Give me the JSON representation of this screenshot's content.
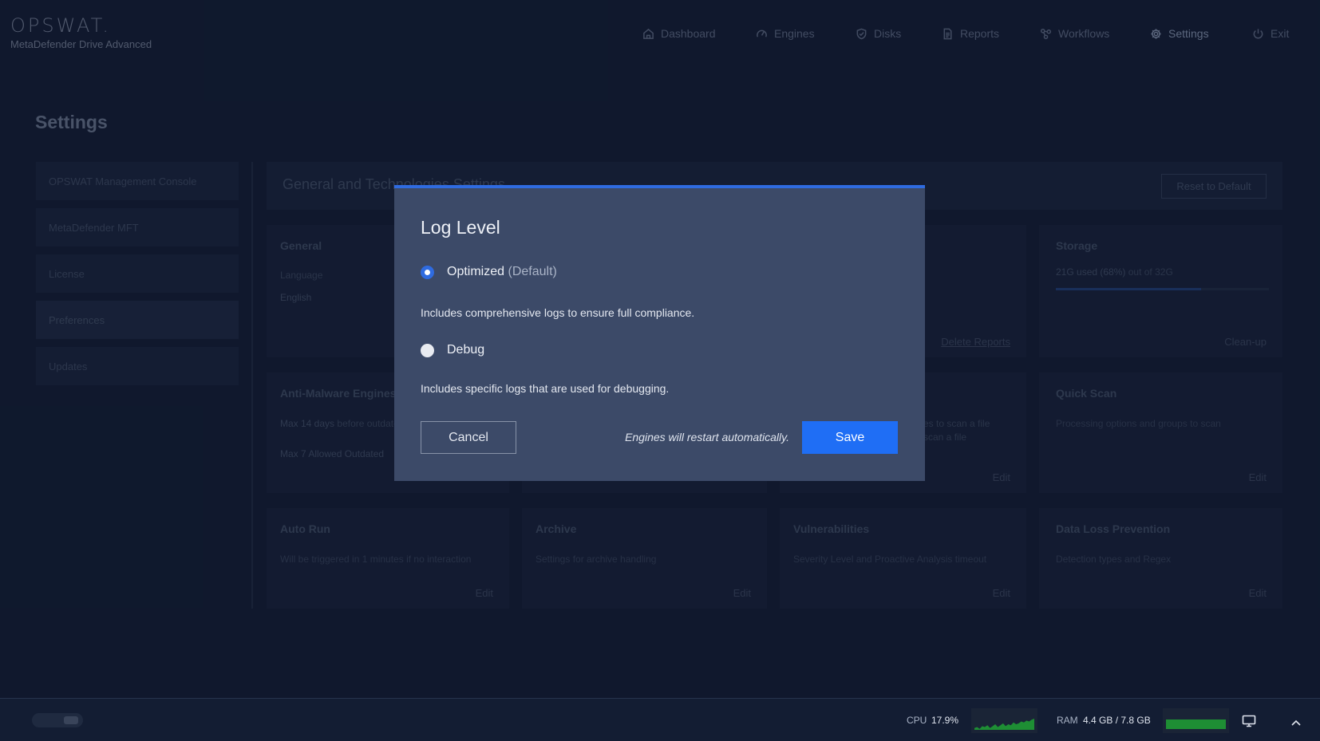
{
  "app": {
    "logo": "OPSWAT.",
    "product_name": "MetaDefender Drive Advanced"
  },
  "nav": [
    {
      "label": "Dashboard",
      "icon": "home-icon"
    },
    {
      "label": "Engines",
      "icon": "gauge-icon"
    },
    {
      "label": "Disks",
      "icon": "shield-check-icon"
    },
    {
      "label": "Reports",
      "icon": "document-icon"
    },
    {
      "label": "Workflows",
      "icon": "workflow-icon"
    },
    {
      "label": "Settings",
      "icon": "gear-icon",
      "active": true
    },
    {
      "label": "Exit",
      "icon": "power-icon"
    }
  ],
  "page": {
    "title": "Settings"
  },
  "sidebar": {
    "items": [
      {
        "label": "OPSWAT Management Console"
      },
      {
        "label": "MetaDefender MFT"
      },
      {
        "label": "License"
      },
      {
        "label": "Preferences",
        "active": true
      },
      {
        "label": "Updates"
      }
    ]
  },
  "main": {
    "section_title": "General and Technologies Settings",
    "reset_label": "Reset to Default",
    "cards": {
      "general": {
        "title": "General",
        "language_label": "Language",
        "language_value": "English"
      },
      "reports": {
        "link": "Delete Reports"
      },
      "storage": {
        "title": "Storage",
        "used": "21G used (68%)",
        "total": "out of 32G",
        "used_fraction": 0.68,
        "action": "Clean-up"
      },
      "anti_malware": {
        "title": "Anti-Malware Engines",
        "line1_value": "Max 14 days",
        "line1_rest": "before outdated",
        "line2_value": "Max 7 Allowed Outdated"
      },
      "file_types": {
        "desc1": "es to scan a file",
        "desc2": "scan a file",
        "edit": "Edit"
      },
      "quick_scan": {
        "title": "Quick Scan",
        "desc": "Processing options and groups to scan",
        "edit": "Edit"
      },
      "auto_run": {
        "title": "Auto Run",
        "desc": "Will be triggered in 1 minutes if no interaction",
        "edit": "Edit"
      },
      "archive": {
        "title": "Archive",
        "desc": "Settings for archive handling",
        "edit": "Edit"
      },
      "vulnerabilities": {
        "title": "Vulnerabilities",
        "desc": "Severity Level and Proactive Analysis timeout",
        "edit": "Edit"
      },
      "dlp": {
        "title": "Data Loss Prevention",
        "desc": "Detection types and Regex",
        "edit": "Edit"
      }
    }
  },
  "modal": {
    "title": "Log Level",
    "options": [
      {
        "label": "Optimized",
        "suffix": "(Default)",
        "desc": "Includes comprehensive logs to ensure full compliance.",
        "selected": true
      },
      {
        "label": "Debug",
        "suffix": "",
        "desc": "Includes specific logs that are used for debugging.",
        "selected": false
      }
    ],
    "cancel_label": "Cancel",
    "note": "Engines will restart automatically.",
    "save_label": "Save"
  },
  "status_bar": {
    "cpu_label": "CPU",
    "cpu_value": "17.9%",
    "ram_label": "RAM",
    "ram_value": "4.4 GB / 7.8 GB",
    "cpu_history": [
      2,
      3,
      1,
      4,
      3,
      5,
      2,
      4,
      6,
      3,
      5,
      7,
      4,
      6,
      5,
      8,
      6,
      7,
      9,
      8,
      10,
      9,
      11,
      12
    ],
    "ram_fraction": 0.56
  },
  "colors": {
    "background": "#14203a",
    "accent": "#1f6ef5",
    "modal_bg": "#3c4a68",
    "graph_green": "#1e8e34"
  }
}
